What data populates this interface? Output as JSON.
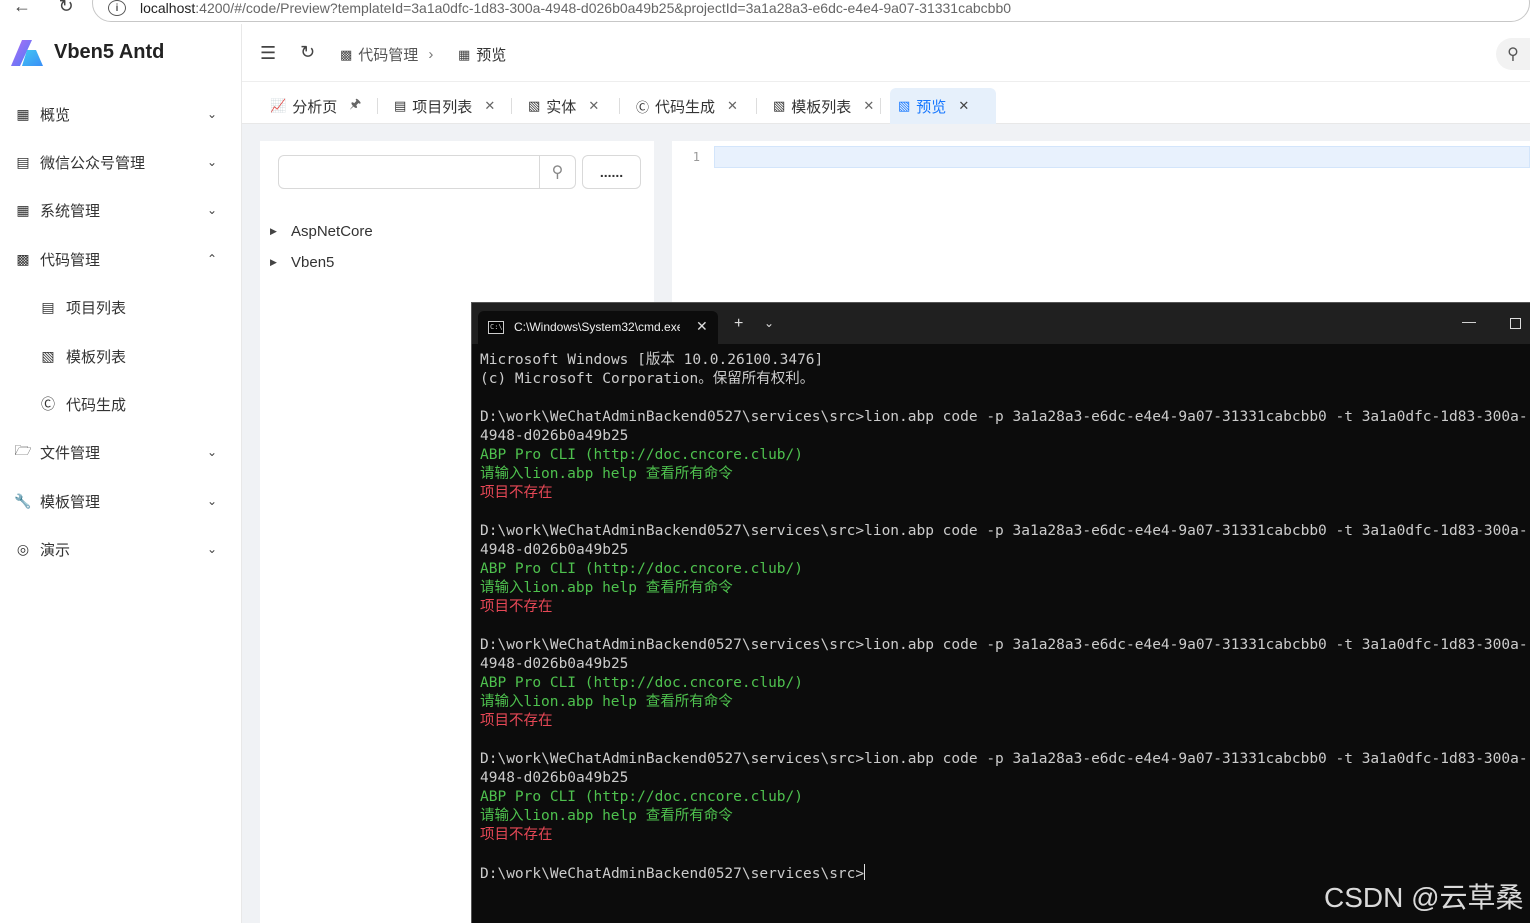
{
  "browser": {
    "url_host": "localhost",
    "url_rest": ":4200/#/code/Preview?templateId=3a1a0dfc-1d83-300a-4948-d026b0a49b25&projectId=3a1a28a3-e6dc-e4e4-9a07-31331cabcbb0"
  },
  "app": {
    "title": "Vben5 Antd"
  },
  "sidebar": {
    "items": [
      {
        "label": "概览",
        "icon": "grid-icon",
        "expanded": false
      },
      {
        "label": "微信公众号管理",
        "icon": "wechat-icon",
        "expanded": false
      },
      {
        "label": "系统管理",
        "icon": "grid-icon",
        "expanded": false
      },
      {
        "label": "代码管理",
        "icon": "paint-roller-icon",
        "expanded": true
      },
      {
        "label": "项目列表",
        "icon": "list-icon",
        "sub": true
      },
      {
        "label": "模板列表",
        "icon": "file-icon",
        "sub": true
      },
      {
        "label": "代码生成",
        "icon": "copyright-icon",
        "sub": true
      },
      {
        "label": "文件管理",
        "icon": "folder-icon",
        "expanded": false
      },
      {
        "label": "模板管理",
        "icon": "wrench-icon",
        "expanded": false
      },
      {
        "label": "演示",
        "icon": "demo-icon",
        "expanded": false
      }
    ]
  },
  "breadcrumb": {
    "parent": "代码管理",
    "current": "预览"
  },
  "tabs": [
    {
      "label": "分析页",
      "icon": "chart-icon",
      "pinned": true
    },
    {
      "label": "项目列表",
      "icon": "list-icon"
    },
    {
      "label": "实体",
      "icon": "file-icon"
    },
    {
      "label": "代码生成",
      "icon": "copyright-icon"
    },
    {
      "label": "模板列表",
      "icon": "file-icon"
    },
    {
      "label": "预览",
      "icon": "file-icon",
      "active": true
    }
  ],
  "tree": {
    "search_placeholder": "",
    "more_label": "......",
    "nodes": [
      "AspNetCore",
      "Vben5"
    ]
  },
  "editor": {
    "line_number": "1"
  },
  "terminal": {
    "tab_title": "C:\\Windows\\System32\\cmd.exe",
    "lines": [
      {
        "text": "Microsoft Windows [版本 10.0.26100.3476]",
        "color": "white"
      },
      {
        "text": "(c) Microsoft Corporation。保留所有权利。",
        "color": "white"
      },
      {
        "text": "",
        "color": "white"
      },
      {
        "text": "D:\\work\\WeChatAdminBackend0527\\services\\src>lion.abp code -p 3a1a28a3-e6dc-e4e4-9a07-31331cabcbb0 -t 3a1a0dfc-1d83-300a-",
        "color": "white"
      },
      {
        "text": "4948-d026b0a49b25",
        "color": "white"
      },
      {
        "text": "ABP Pro CLI (http://doc.cncore.club/)",
        "color": "green"
      },
      {
        "text": "请输入lion.abp help 查看所有命令",
        "color": "green"
      },
      {
        "text": "项目不存在",
        "color": "red"
      },
      {
        "text": "",
        "color": "white"
      },
      {
        "text": "D:\\work\\WeChatAdminBackend0527\\services\\src>lion.abp code -p 3a1a28a3-e6dc-e4e4-9a07-31331cabcbb0 -t 3a1a0dfc-1d83-300a-",
        "color": "white"
      },
      {
        "text": "4948-d026b0a49b25",
        "color": "white"
      },
      {
        "text": "ABP Pro CLI (http://doc.cncore.club/)",
        "color": "green"
      },
      {
        "text": "请输入lion.abp help 查看所有命令",
        "color": "green"
      },
      {
        "text": "项目不存在",
        "color": "red"
      },
      {
        "text": "",
        "color": "white"
      },
      {
        "text": "D:\\work\\WeChatAdminBackend0527\\services\\src>lion.abp code -p 3a1a28a3-e6dc-e4e4-9a07-31331cabcbb0 -t 3a1a0dfc-1d83-300a-",
        "color": "white"
      },
      {
        "text": "4948-d026b0a49b25",
        "color": "white"
      },
      {
        "text": "ABP Pro CLI (http://doc.cncore.club/)",
        "color": "green"
      },
      {
        "text": "请输入lion.abp help 查看所有命令",
        "color": "green"
      },
      {
        "text": "项目不存在",
        "color": "red"
      },
      {
        "text": "",
        "color": "white"
      },
      {
        "text": "D:\\work\\WeChatAdminBackend0527\\services\\src>lion.abp code -p 3a1a28a3-e6dc-e4e4-9a07-31331cabcbb0 -t 3a1a0dfc-1d83-300a-",
        "color": "white"
      },
      {
        "text": "4948-d026b0a49b25",
        "color": "white"
      },
      {
        "text": "ABP Pro CLI (http://doc.cncore.club/)",
        "color": "green"
      },
      {
        "text": "请输入lion.abp help 查看所有命令",
        "color": "green"
      },
      {
        "text": "项目不存在",
        "color": "red"
      },
      {
        "text": "",
        "color": "white"
      },
      {
        "text": "D:\\work\\WeChatAdminBackend0527\\services\\src>",
        "color": "white",
        "cursor": true
      }
    ]
  },
  "watermark": "CSDN @云草桑",
  "colors": {
    "accent": "#1677ff",
    "active_tab_bg": "#e6f0fb",
    "terminal_bg": "#0c0c0c",
    "terminal_green": "#4ec14e",
    "terminal_red": "#e74856"
  }
}
